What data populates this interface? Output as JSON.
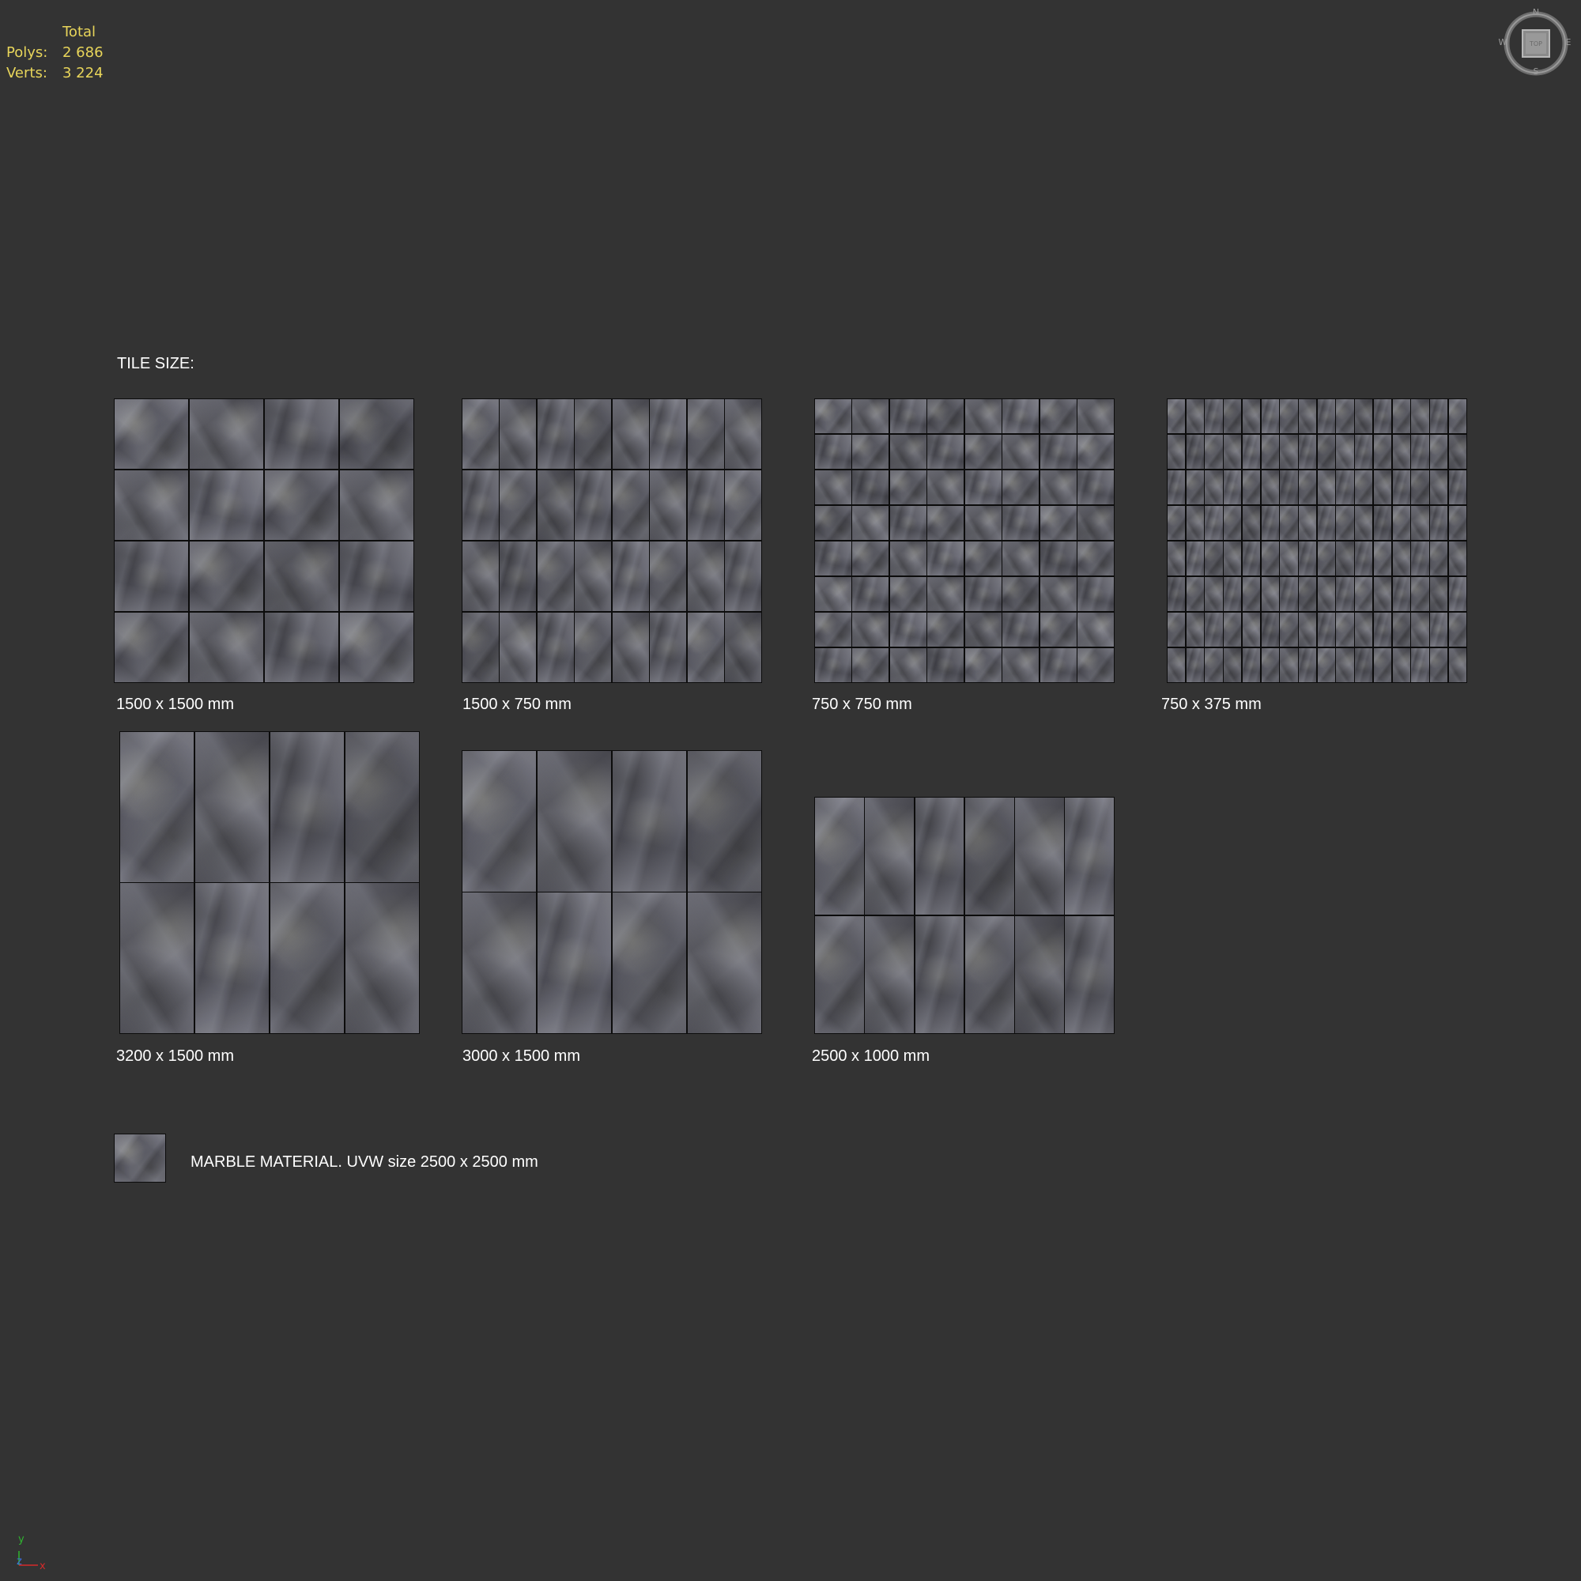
{
  "viewport": {
    "background": "#333333",
    "stats": {
      "header": "Total",
      "polys_label": "Polys:",
      "polys_value": "2 686",
      "verts_label": "Verts:",
      "verts_value": "3 224",
      "color": "#e8d55a"
    },
    "viewcube": {
      "face_label": "TOP",
      "north": "N",
      "south": "S",
      "east": "E",
      "west": "W"
    },
    "axis_gizmo": {
      "y": "y",
      "z": "z",
      "x": "x"
    }
  },
  "scene": {
    "heading": "TILE SIZE:",
    "samples": [
      {
        "label": "1500 x 1500 mm",
        "cols": 4,
        "rows": 4
      },
      {
        "label": "1500 x 750 mm",
        "cols": 8,
        "rows": 4
      },
      {
        "label": "750 x 750 mm",
        "cols": 8,
        "rows": 8
      },
      {
        "label": "750 x 375 mm",
        "cols": 16,
        "rows": 8
      },
      {
        "label": "3200 x 1500 mm",
        "cols": 4,
        "rows": 2
      },
      {
        "label": "3000 x 1500 mm",
        "cols": 4,
        "rows": 2
      },
      {
        "label": "2500 x 1000 mm",
        "cols": 6,
        "rows": 2
      }
    ],
    "material_note": "MARBLE MATERIAL. UVW size 2500 x 2500 mm"
  }
}
